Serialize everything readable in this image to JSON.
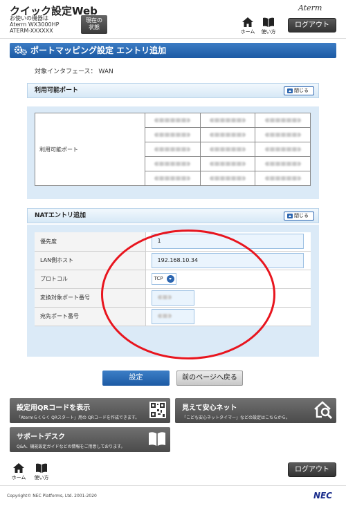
{
  "header": {
    "app_title": "クイック設定Web",
    "device_lines": [
      "お使いの機器は",
      "Aterm WX3000HP",
      "ATERM-XXXXXX"
    ],
    "status_button": [
      "現在の",
      "状態"
    ],
    "brand": "Aterm",
    "home_label": "ホーム",
    "usage_label": "使い方",
    "logout_label": "ログアウト"
  },
  "page": {
    "title": "ポートマッピング設定 エントリ追加",
    "interface_line": "対象インタフェース： WAN"
  },
  "available_ports": {
    "heading": "利用可能ポート",
    "close_label": "閉じる",
    "row_label": "利用可能ポート"
  },
  "nat": {
    "heading": "NATエントリ追加",
    "close_label": "閉じる",
    "rows": [
      {
        "label": "優先度",
        "value": "1"
      },
      {
        "label": "LAN側ホスト",
        "value": "192.168.10.34"
      },
      {
        "label": "プロトコル",
        "value": "TCP"
      },
      {
        "label": "変換対象ポート番号",
        "value": ""
      },
      {
        "label": "宛先ポート番号",
        "value": ""
      }
    ]
  },
  "actions": {
    "submit": "設定",
    "back": "前のページへ戻る"
  },
  "tiles": [
    {
      "title": "設定用QRコードを表示",
      "desc": "「Atermらくらく QRスタート」用の QRコードを作成できます。",
      "icon": "qr-code-icon"
    },
    {
      "title": "見えて安心ネット",
      "desc": "「こども安心ネットタイマー」などの設定はこちらから。",
      "icon": "house-search-icon"
    },
    {
      "title": "サポートデスク",
      "desc": "Q&A、機能設定ガイドなどの情報をご用意しております。",
      "icon": "book-icon"
    }
  ],
  "footer": {
    "home_label": "ホーム",
    "usage_label": "使い方",
    "logout_label": "ログアウト",
    "copyright": "Copyright© NEC Platforms, Ltd. 2001-2020",
    "nec_logo": "NEC"
  },
  "colors": {
    "accent_blue": "#1c5aa4",
    "annotation_red": "#e8151e"
  }
}
